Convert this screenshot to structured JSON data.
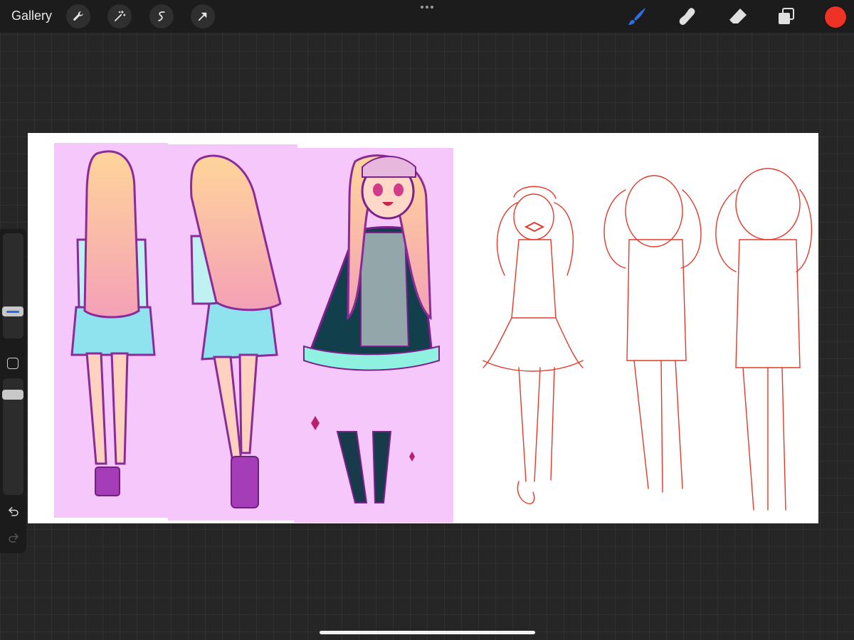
{
  "topbar": {
    "gallery_label": "Gallery",
    "left_tools": [
      {
        "name": "actions",
        "icon": "wrench-icon"
      },
      {
        "name": "adjustments",
        "icon": "magic-wand-icon"
      },
      {
        "name": "selection",
        "icon": "selection-s-icon"
      },
      {
        "name": "transform",
        "icon": "arrow-cursor-icon"
      }
    ],
    "more_icon": "more-dots-icon",
    "right_tools": [
      {
        "name": "brush",
        "icon": "brush-icon",
        "active": true
      },
      {
        "name": "smudge",
        "icon": "smudge-icon",
        "active": false
      },
      {
        "name": "eraser",
        "icon": "eraser-icon",
        "active": false
      },
      {
        "name": "layers",
        "icon": "layers-icon",
        "active": false
      }
    ],
    "current_color": "#ee3326",
    "active_tool_color": "#2f6fe4"
  },
  "sidebar": {
    "modify_icon": "square-modify-icon",
    "undo_icon": "undo-arrow-icon",
    "redo_icon": "redo-arrow-icon"
  },
  "canvas": {
    "background": "#ffffff",
    "panel_color": "#f5c7fb",
    "sketch_color": "#e2392c"
  }
}
